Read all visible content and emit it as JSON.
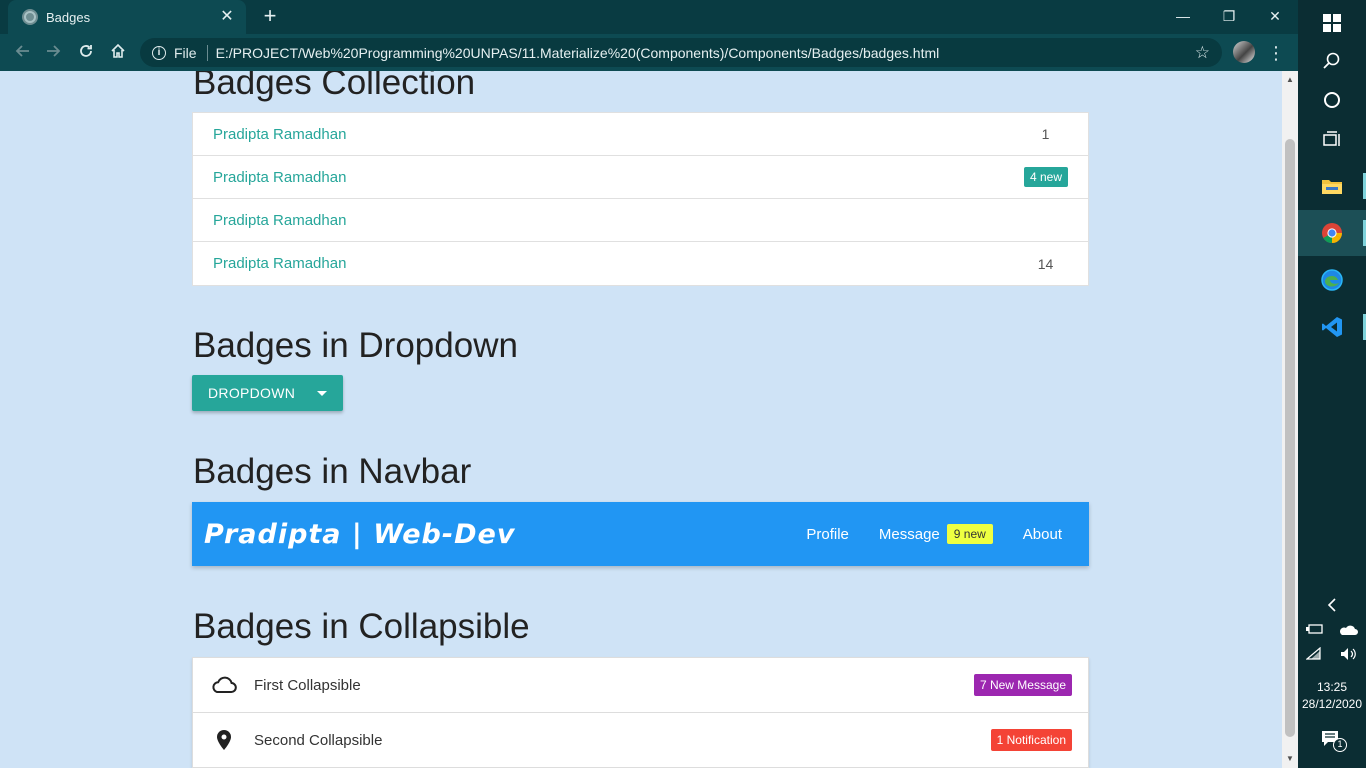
{
  "browser": {
    "tab_title": "Badges",
    "tab_close": "✕",
    "new_tab": "+",
    "window_buttons": [
      "—",
      "❐",
      "✕"
    ],
    "omnibox_scheme": "File",
    "url": "E:/PROJECT/Web%20Programming%20UNPAS/11.Materialize%20(Components)/Components/Badges/badges.html"
  },
  "sections": {
    "collection_title": "Badges Collection",
    "dropdown_title": "Badges in Dropdown",
    "navbar_title": "Badges in Navbar",
    "collapsible_title": "Badges in Collapsible"
  },
  "collection": {
    "items": [
      {
        "label": "Pradipta Ramadhan",
        "badge": "1"
      },
      {
        "label": "Pradipta Ramadhan",
        "badge": "4 new"
      },
      {
        "label": "Pradipta Ramadhan",
        "badge": ""
      },
      {
        "label": "Pradipta Ramadhan",
        "badge": "14"
      }
    ]
  },
  "dropdown": {
    "label": "DROPDOWN"
  },
  "navbar": {
    "brand": "Pradipta | Web-Dev",
    "links": {
      "profile": "Profile",
      "message": "Message",
      "message_badge": "9 new",
      "about": "About"
    }
  },
  "collapsible": {
    "items": [
      {
        "icon": "cloud-icon",
        "label": "First Collapsible",
        "badge": "7 New Message",
        "badge_color": "#9c27b0"
      },
      {
        "icon": "place-icon",
        "label": "Second Collapsible",
        "badge": "1 Notification",
        "badge_color": "#f44336"
      }
    ]
  },
  "colors": {
    "teal": "#26a69a",
    "navbar_blue": "#2196f3",
    "lime_badge": "#eeff41",
    "page_bg": "#cfe3f6"
  },
  "taskbar": {
    "time": "13:25",
    "date": "28/12/2020",
    "notifications": "1"
  }
}
